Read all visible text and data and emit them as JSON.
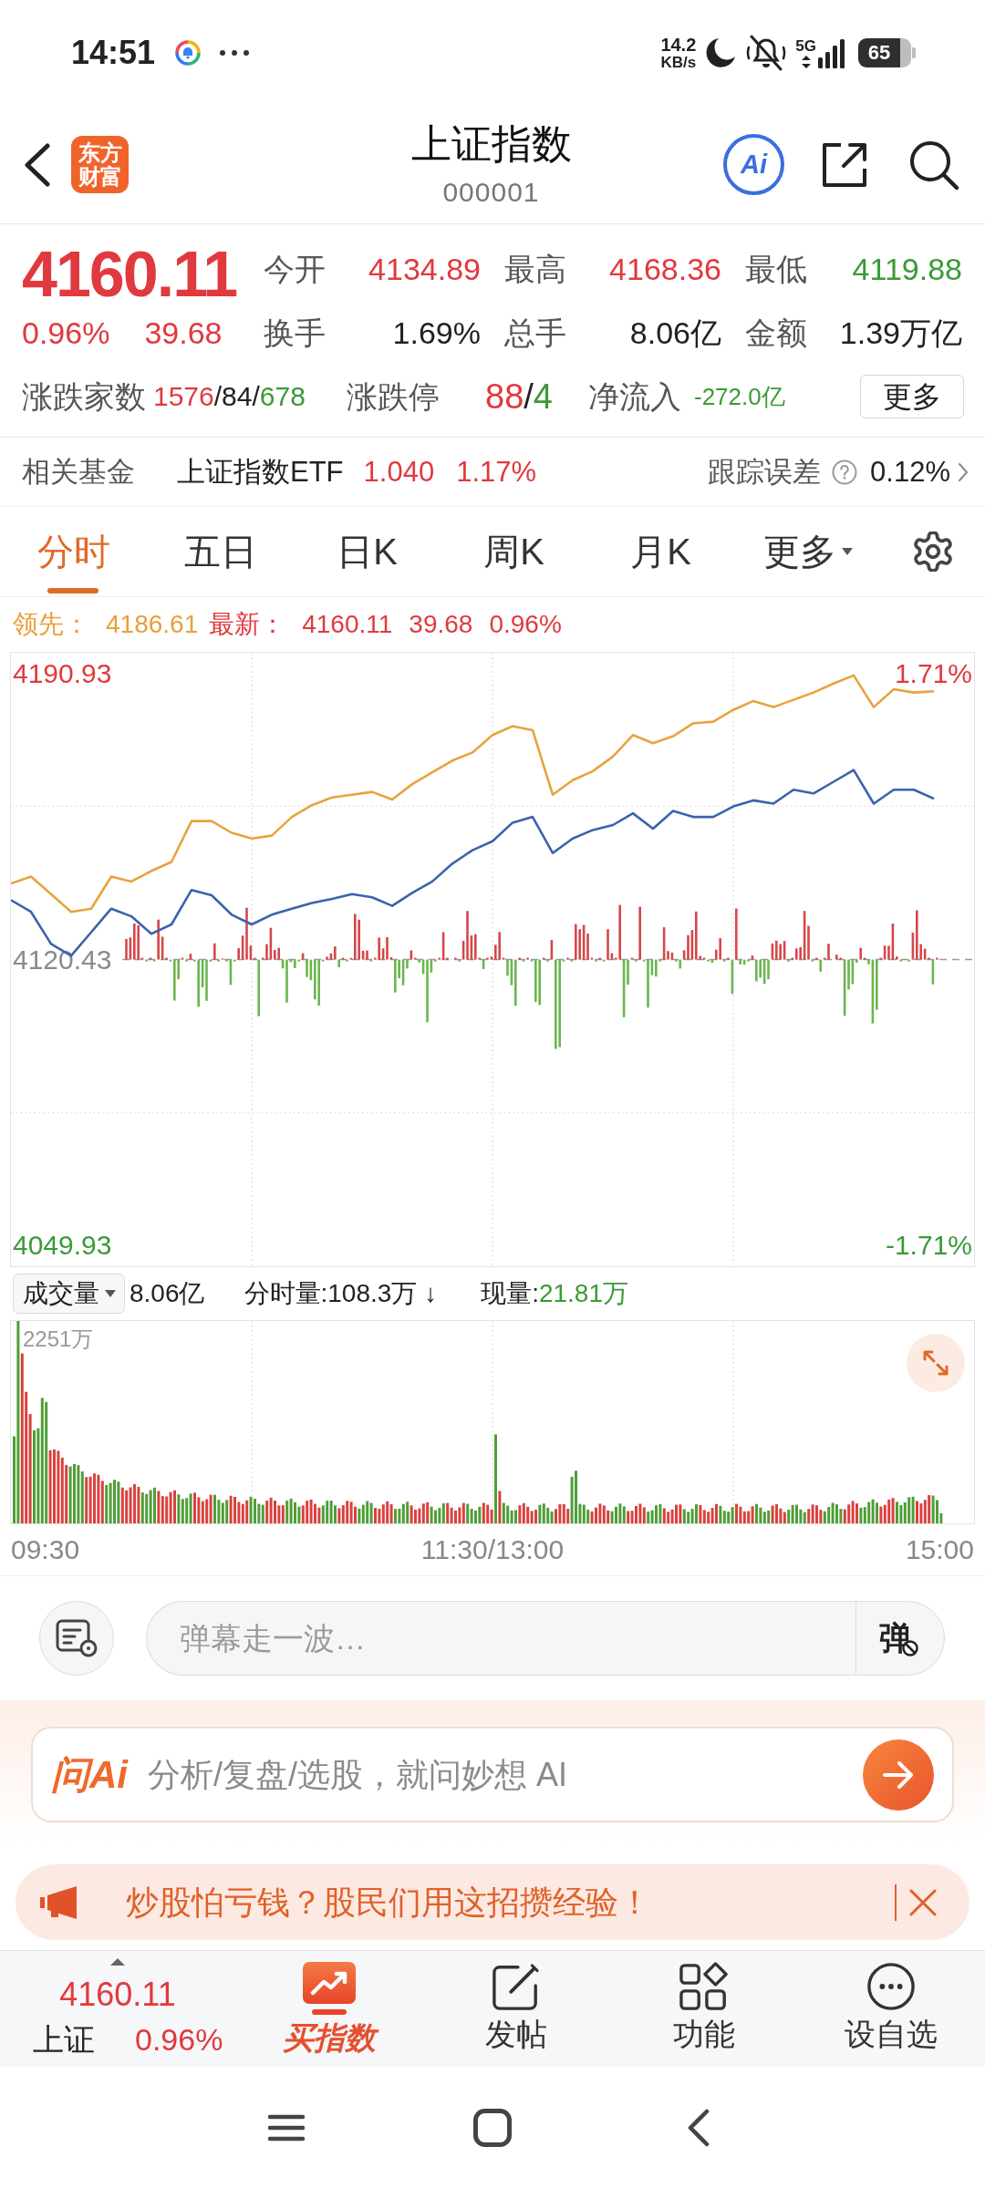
{
  "status_bar": {
    "time": "14:51",
    "net_speed": "14.2",
    "net_unit": "KB/s",
    "network": "5G",
    "battery": "65"
  },
  "header": {
    "logo_lines": [
      "东方",
      "财富"
    ],
    "title": "上证指数",
    "code": "000001",
    "ai_label": "Ai"
  },
  "quote": {
    "price": "4160.11",
    "change_pct": "0.96%",
    "change": "39.68",
    "color": "#e0393e",
    "stats": [
      {
        "label": "今开",
        "value": "4134.89",
        "color": "#e0393e"
      },
      {
        "label": "最高",
        "value": "4168.36",
        "color": "#e0393e"
      },
      {
        "label": "最低",
        "value": "4119.88",
        "color": "#3a9a36"
      },
      {
        "label": "换手",
        "value": "1.69%",
        "color": "#222222"
      },
      {
        "label": "总手",
        "value": "8.06亿",
        "color": "#222222"
      },
      {
        "label": "金额",
        "value": "1.39万亿",
        "color": "#222222"
      }
    ],
    "breadth": [
      {
        "label": "涨跌家数",
        "parts": [
          {
            "text": "1576",
            "color": "#e0393e"
          },
          {
            "text": "/84/",
            "color": "#222222"
          },
          {
            "text": "678",
            "color": "#3a9a36"
          }
        ]
      },
      {
        "label": "涨跌停",
        "parts": [
          {
            "text": "88",
            "color": "#e0393e"
          },
          {
            "text": "/",
            "color": "#222222"
          },
          {
            "text": "4",
            "color": "#3a9a36"
          }
        ]
      },
      {
        "label": "净流入",
        "parts": [
          {
            "text": "-272.0亿",
            "color": "#3a9a36"
          }
        ]
      }
    ],
    "more_button": "更多"
  },
  "fund": {
    "label": "相关基金",
    "name": "上证指数ETF",
    "price": "1.040",
    "change": "1.17%",
    "color": "#e0393e",
    "tracking_label": "跟踪误差",
    "tracking_value": "0.12%"
  },
  "tabs": [
    {
      "label": "分时",
      "selected": true,
      "dropdown": false
    },
    {
      "label": "五日",
      "selected": false,
      "dropdown": false
    },
    {
      "label": "日K",
      "selected": false,
      "dropdown": false
    },
    {
      "label": "周K",
      "selected": false,
      "dropdown": false
    },
    {
      "label": "月K",
      "selected": false,
      "dropdown": false
    },
    {
      "label": "更多",
      "selected": false,
      "dropdown": true
    }
  ],
  "legend": [
    {
      "color": "#e8a03a",
      "values": [
        "4186.61"
      ]
    },
    {
      "color": "#e0393e",
      "values": [
        "4160.11",
        "39.68",
        "0.96%"
      ]
    }
  ],
  "price_chart": {
    "right_labels": [
      {
        "text": "1.71%",
        "color": "#e0393e"
      },
      {
        "text": "-1.71%",
        "color": "#3a9a36"
      }
    ],
    "chart_data": {
      "type": "line",
      "categories": [
        null,
        null,
        null,
        null,
        null,
        null,
        null,
        null,
        null,
        null,
        null,
        null,
        null,
        null,
        null,
        null,
        null,
        null,
        null,
        null,
        null,
        null,
        null,
        null,
        null,
        null,
        null,
        null,
        null,
        null,
        null,
        null,
        null,
        null,
        null,
        null,
        null,
        null,
        null,
        null,
        null,
        null,
        null,
        null,
        null,
        null,
        null,
        null,
        null
      ],
      "ylim": [
        4044.8,
        4196.1
      ],
      "yticks": [
        {
          "value": 4190.93,
          "label": "4190.93"
        },
        {
          "value": 4120.43,
          "label": "4120.43"
        },
        {
          "value": 4049.93,
          "label": "4049.93"
        }
      ],
      "series": [
        {
          "name": "领先：",
          "color": "#e8a33d",
          "values": [
            4139.2,
            4140.9,
            4136.6,
            4132.2,
            4133.0,
            4140.9,
            4139.7,
            4142.3,
            4144.5,
            4154.6,
            4154.6,
            4151.7,
            4150.3,
            4151.0,
            4155.6,
            4158.5,
            4160.4,
            4161.1,
            4161.8,
            4159.9,
            4163.7,
            4166.6,
            4169.5,
            4171.5,
            4175.8,
            4178.0,
            4177.0,
            4161.1,
            4164.7,
            4166.9,
            4170.5,
            4175.8,
            4173.8,
            4175.5,
            4178.7,
            4179.1,
            4182.0,
            4184.2,
            4182.7,
            4184.5,
            4186.3,
            4188.5,
            4190.5,
            4182.7,
            4187.1,
            4186.3,
            4186.6,
            null,
            null
          ]
        },
        {
          "name": "最新：",
          "color": "#3b63ac",
          "values": [
            4135.1,
            4132.2,
            4124.3,
            4121.4,
            4127.2,
            4133.0,
            4131.1,
            4126.8,
            4129.1,
            4137.6,
            4136.3,
            4131.5,
            4129.1,
            4131.5,
            4133.0,
            4134.4,
            4135.4,
            4136.6,
            4135.8,
            4133.7,
            4136.9,
            4139.7,
            4144.1,
            4147.4,
            4149.6,
            4154.2,
            4155.6,
            4146.7,
            4150.3,
            4152.4,
            4153.6,
            4156.5,
            4152.7,
            4157.1,
            4155.6,
            4155.6,
            4158.2,
            4159.7,
            4158.9,
            4162.3,
            4161.4,
            4164.3,
            4167.2,
            4158.9,
            4162.3,
            4162.3,
            4160.1,
            null,
            null
          ]
        }
      ]
    }
  },
  "volume": {
    "dropdown_label": "成交量",
    "total": "8.06亿",
    "minute_volume": "分时量:108.3万 ↓",
    "current": {
      "label": "现量:",
      "value": "21.81万",
      "color": "#3a9a36"
    },
    "max_label": "2251万"
  },
  "time_axis": [
    "09:30",
    "11:30/13:00",
    "15:00"
  ],
  "comment_bar": {
    "placeholder": "弹幕走一波…",
    "button": "弹"
  },
  "ask_ai": {
    "logo": "问Ai",
    "placeholder": "分析/复盘/选股，就问妙想 AI"
  },
  "banner": {
    "text": "炒股怕亏钱？股民们用这招攒经验！"
  },
  "bottom_nav": {
    "index": {
      "price": "4160.11",
      "name": "上证",
      "change_pct": "0.96%",
      "color": "#e0393e"
    },
    "items": [
      {
        "label": "买指数",
        "kind": "promo"
      },
      {
        "label": "发帖",
        "kind": "post"
      },
      {
        "label": "功能",
        "kind": "apps"
      },
      {
        "label": "设自选",
        "kind": "watch"
      }
    ]
  }
}
